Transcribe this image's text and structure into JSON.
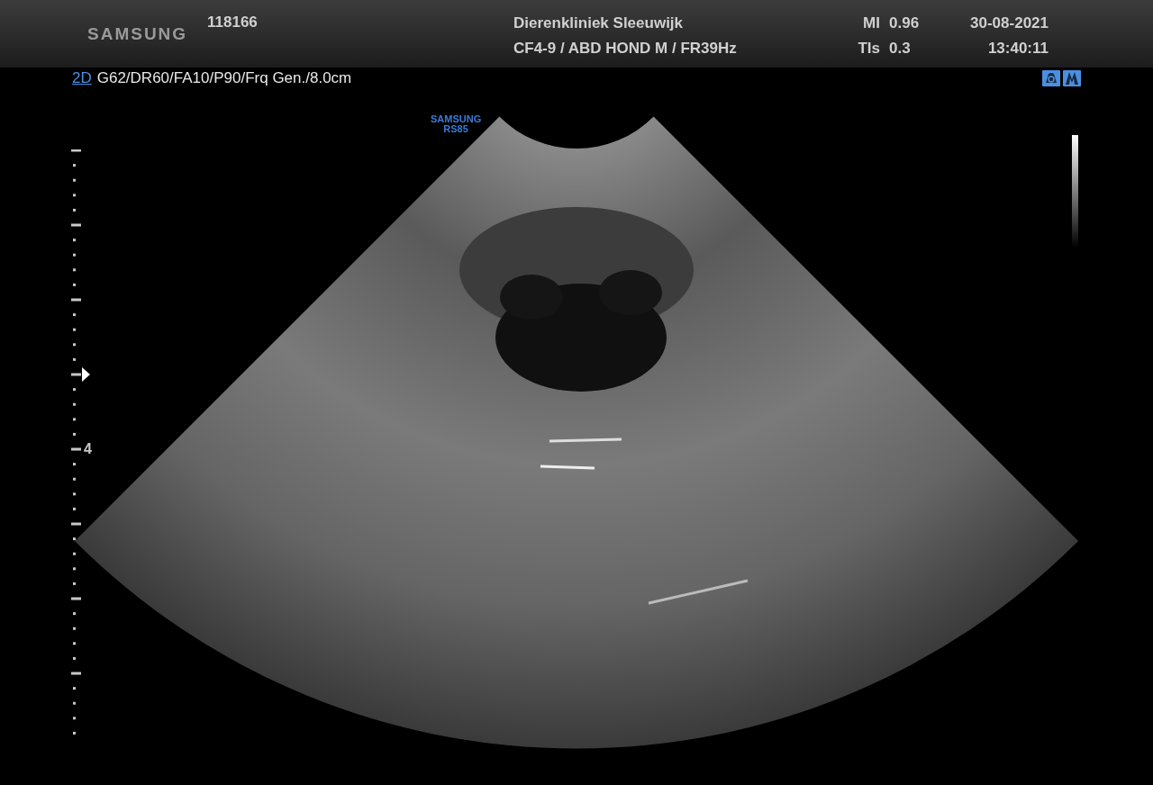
{
  "header": {
    "logo": "SAMSUNG",
    "patient_id": "118166",
    "institution": "Dierenkliniek Sleeuwijk",
    "probe_info": "CF4-9 / ABD HOND M / FR39Hz",
    "indices": [
      {
        "label": "MI",
        "value": "0.96"
      },
      {
        "label": "TIs",
        "value": "0.3"
      }
    ],
    "date": "30-08-2021",
    "time": "13:40:11"
  },
  "imaging": {
    "mode": "2D",
    "params": "G62/DR60/FA10/P90/Frq Gen./8.0cm"
  },
  "device_label": {
    "brand": "SAMSUNG",
    "model": "RS85"
  },
  "depth_scale": {
    "label": "4"
  }
}
